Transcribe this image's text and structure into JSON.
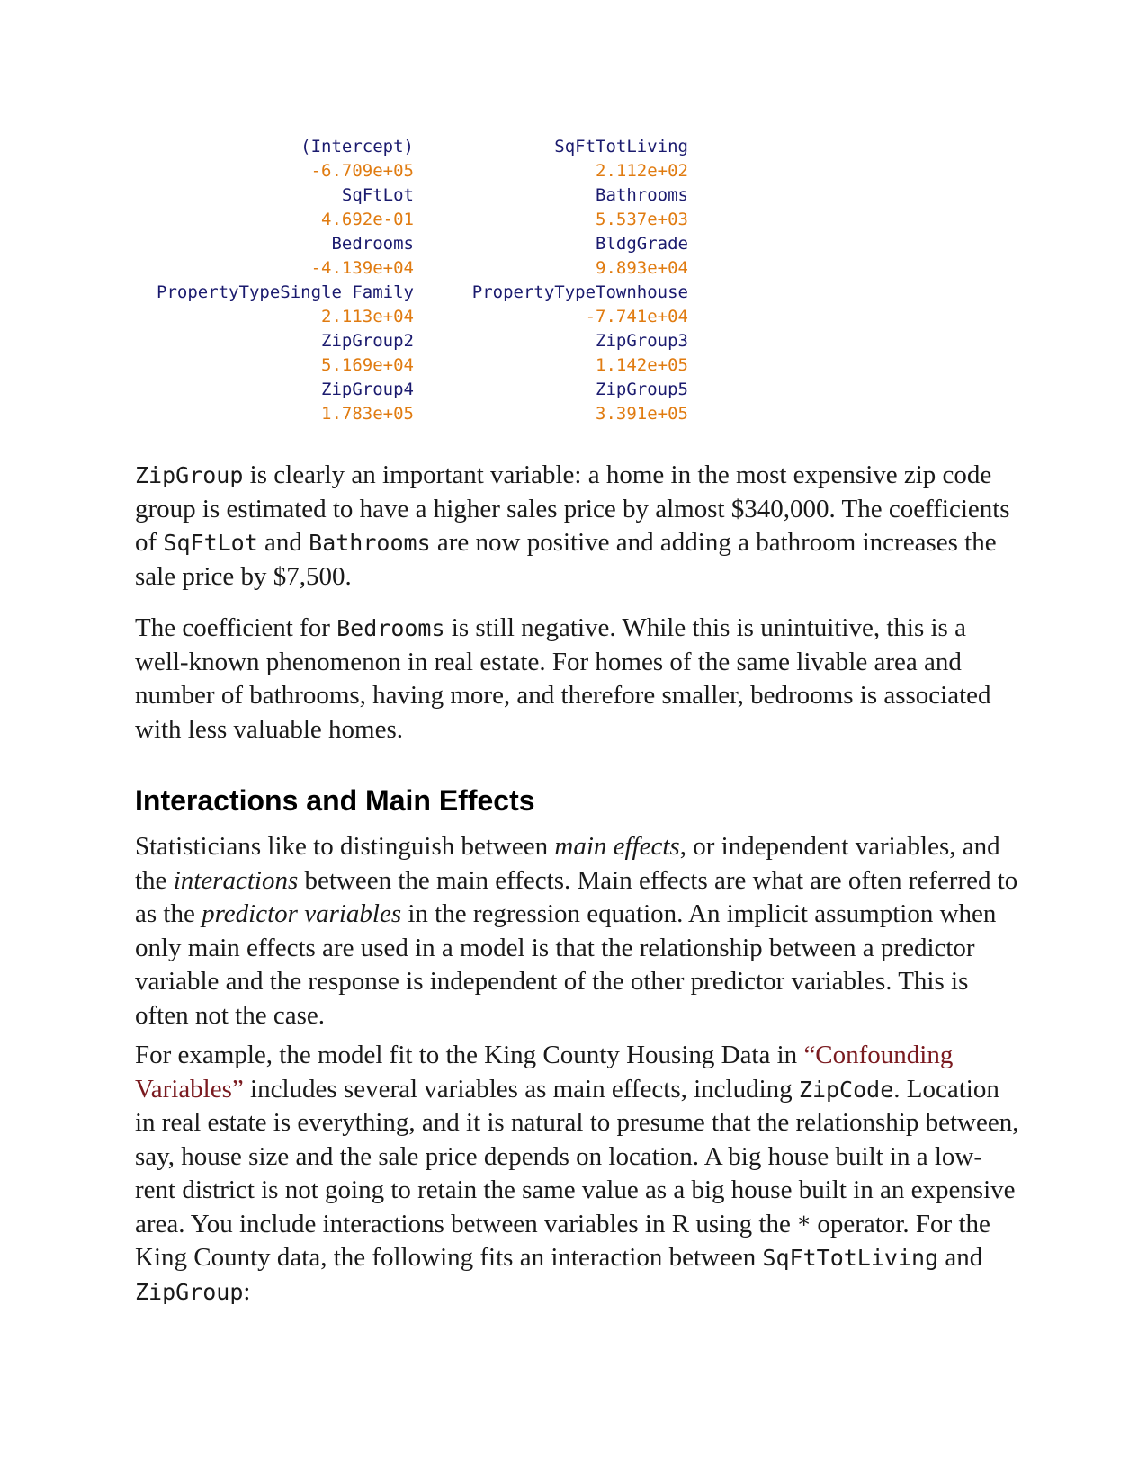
{
  "coefficients": [
    [
      {
        "name": "(Intercept)",
        "value": "-6.709e+05"
      },
      {
        "name": "SqFtTotLiving",
        "value": "2.112e+02"
      }
    ],
    [
      {
        "name": "SqFtLot",
        "value": "4.692e-01"
      },
      {
        "name": "Bathrooms",
        "value": "5.537e+03"
      }
    ],
    [
      {
        "name": "Bedrooms",
        "value": "-4.139e+04"
      },
      {
        "name": "BldgGrade",
        "value": "9.893e+04"
      }
    ],
    [
      {
        "name": "PropertyTypeSingle Family",
        "value": "2.113e+04"
      },
      {
        "name": "PropertyTypeTownhouse",
        "value": "-7.741e+04"
      }
    ],
    [
      {
        "name": "ZipGroup2",
        "value": "5.169e+04"
      },
      {
        "name": "ZipGroup3",
        "value": "1.142e+05"
      }
    ],
    [
      {
        "name": "ZipGroup4",
        "value": "1.783e+05"
      },
      {
        "name": "ZipGroup5",
        "value": "3.391e+05"
      }
    ]
  ],
  "para1": {
    "code1": "ZipGroup",
    "t1": " is clearly an important variable: a home in the most expensive zip code group is estimated to have a higher sales price by almost $340,000. The coefficients of ",
    "code2": "SqFtLot",
    "t2": " and ",
    "code3": "Bathrooms",
    "t3": " are now positive and adding a bathroom increases the sale price by $7,500."
  },
  "para2": {
    "t1": "The coefficient for ",
    "code1": "Bedrooms",
    "t2": " is still negative. While this is unintuitive, this is a well-known phenomenon in real estate. For homes of the same livable area and number of bathrooms, having more, and therefore smaller, bedrooms is associated with less valuable homes."
  },
  "heading": "Interactions and Main Effects",
  "para3": {
    "t1": "Statisticians like to distinguish between ",
    "em1": "main effects",
    "t2": ", or independent variables, and the ",
    "em2": "interactions",
    "t3": " between the main effects. Main effects are what are often referred to as the ",
    "em3": "predictor variables",
    "t4": " in the regression equation. An implicit assumption when only main effects are used in a model is that the relationship between a predictor variable and the response is independent of the other predictor variables. This is often not the case."
  },
  "para4": {
    "t1": "For example, the model fit to the King County Housing Data in ",
    "link": "“Confounding Variables”",
    "t2": " includes several variables as main effects, including ",
    "code1": "ZipCode",
    "t3": ". Location in real estate is everything, and it is natural to presume that the relationship between, say, house size and the sale price depends on location. A big house built in a low-rent district is not going to retain the same value as a big house built in an expensive area. You include interactions between variables in R using the ",
    "code2": "*",
    "t4": " operator. For the King County data, the following fits an interaction between ",
    "code3": "SqFtTotLiving",
    "t5": " and ",
    "code4": "ZipGroup",
    "t6": ":"
  }
}
